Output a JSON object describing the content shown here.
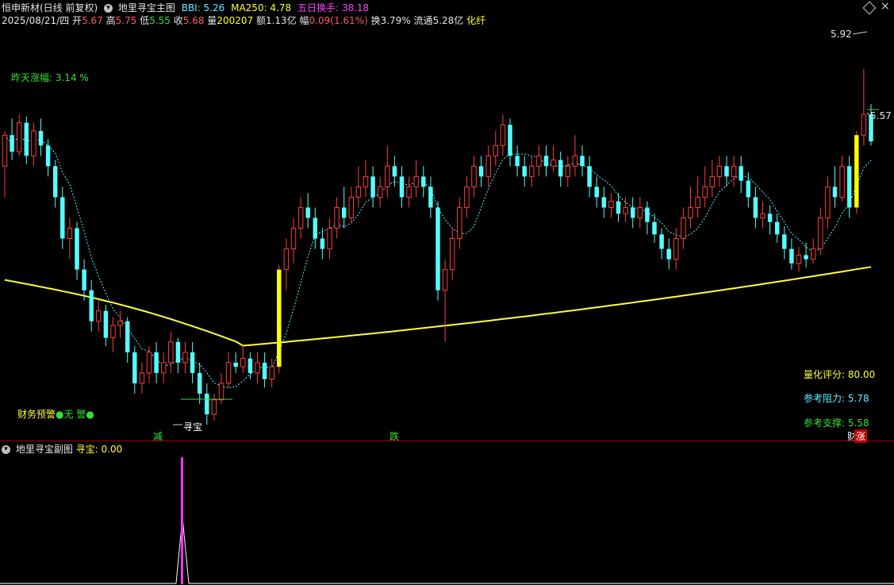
{
  "header": {
    "stock": "恒申新材(日线 前复权)",
    "indicator_main": "地里寻宝主图",
    "bbi": "BBI: 5.26",
    "ma250": "MA250: 4.78",
    "turnover5": "五日换手: 38.18"
  },
  "quote": {
    "date": "2025/08/21/四",
    "open_label": "开",
    "open": "5.67",
    "high_label": "高",
    "high": "5.75",
    "low_label": "低",
    "low": "5.55",
    "close_label": "收",
    "close": "5.68",
    "vol_label": "量",
    "vol": "200207",
    "amount_label": "额",
    "amount": "1.13亿",
    "range_label": "幅",
    "range": "0.09(1.61%)",
    "turnover_label": "换",
    "turnover": "3.79%",
    "float_label": "流通",
    "float": "5.28亿",
    "sector": "化纤"
  },
  "annotations": {
    "prev_change": "昨天涨幅: 3.14 %",
    "finance_warning": "财务预警",
    "no_warning": "无 警",
    "label_jian": "减",
    "label_xunbao": "寻宝",
    "label_die": "跌",
    "label_zhang": "涨",
    "label_cai": "财",
    "high_price": "5.92",
    "last_price": "5.57",
    "score": "量化评分: 80.00",
    "resistance": "参考阻力: 5.78",
    "support": "参考支撑: 5.58"
  },
  "sub_header": {
    "title": "地里寻宝副图",
    "value": "寻宝: 0.00"
  },
  "colors": {
    "up": "#ff3c3c",
    "down": "#54ffff",
    "ma250": "#ffff3c",
    "bbi": "#5ff0ff",
    "signal_bar": "#ffff00",
    "spike": "#ff30ff"
  },
  "chart_data": {
    "type": "candlestick",
    "price_range": [
      4.2,
      6.1
    ],
    "candles": [
      [
        5.45,
        5.6,
        5.62,
        5.3
      ],
      [
        5.6,
        5.52,
        5.68,
        5.48
      ],
      [
        5.52,
        5.66,
        5.7,
        5.5
      ],
      [
        5.66,
        5.5,
        5.69,
        5.46
      ],
      [
        5.5,
        5.62,
        5.66,
        5.45
      ],
      [
        5.62,
        5.55,
        5.68,
        5.5
      ],
      [
        5.55,
        5.45,
        5.58,
        5.4
      ],
      [
        5.45,
        5.3,
        5.48,
        5.25
      ],
      [
        5.3,
        5.1,
        5.35,
        5.05
      ],
      [
        5.1,
        5.15,
        5.2,
        5.0
      ],
      [
        5.15,
        4.95,
        5.18,
        4.9
      ],
      [
        4.95,
        4.85,
        5.0,
        4.8
      ],
      [
        4.85,
        4.7,
        4.9,
        4.65
      ],
      [
        4.7,
        4.75,
        4.8,
        4.65
      ],
      [
        4.75,
        4.62,
        4.78,
        4.58
      ],
      [
        4.62,
        4.68,
        4.72,
        4.55
      ],
      [
        4.68,
        4.7,
        4.75,
        4.62
      ],
      [
        4.7,
        4.55,
        4.72,
        4.5
      ],
      [
        4.55,
        4.4,
        4.58,
        4.35
      ],
      [
        4.4,
        4.45,
        4.5,
        4.35
      ],
      [
        4.45,
        4.55,
        4.58,
        4.4
      ],
      [
        4.55,
        4.45,
        4.6,
        4.4
      ],
      [
        4.45,
        4.5,
        4.55,
        4.4
      ],
      [
        4.5,
        4.6,
        4.65,
        4.45
      ],
      [
        4.6,
        4.5,
        4.62,
        4.45
      ],
      [
        4.5,
        4.55,
        4.6,
        4.45
      ],
      [
        4.55,
        4.45,
        4.6,
        4.4
      ],
      [
        4.45,
        4.35,
        4.5,
        4.3
      ],
      [
        4.35,
        4.25,
        4.4,
        4.2
      ],
      [
        4.25,
        4.32,
        4.35,
        4.22
      ],
      [
        4.32,
        4.4,
        4.45,
        4.3
      ],
      [
        4.4,
        4.5,
        4.55,
        4.38
      ],
      [
        4.5,
        4.48,
        4.55,
        4.45
      ],
      [
        4.48,
        4.52,
        4.58,
        4.45
      ],
      [
        4.52,
        4.45,
        4.55,
        4.42
      ],
      [
        4.45,
        4.5,
        4.55,
        4.4
      ],
      [
        4.5,
        4.42,
        4.55,
        4.38
      ],
      [
        4.42,
        4.48,
        4.52,
        4.38
      ],
      [
        4.48,
        4.95,
        4.97,
        4.45
      ],
      [
        4.95,
        5.05,
        5.1,
        4.85
      ],
      [
        5.05,
        5.15,
        5.2,
        4.98
      ],
      [
        5.15,
        5.25,
        5.3,
        5.1
      ],
      [
        5.25,
        5.2,
        5.32,
        5.15
      ],
      [
        5.2,
        5.1,
        5.25,
        5.05
      ],
      [
        5.1,
        5.05,
        5.15,
        5.0
      ],
      [
        5.05,
        5.15,
        5.2,
        5.0
      ],
      [
        5.15,
        5.25,
        5.3,
        5.1
      ],
      [
        5.25,
        5.2,
        5.35,
        5.15
      ],
      [
        5.2,
        5.3,
        5.35,
        5.18
      ],
      [
        5.3,
        5.35,
        5.45,
        5.25
      ],
      [
        5.35,
        5.4,
        5.48,
        5.3
      ],
      [
        5.4,
        5.3,
        5.45,
        5.25
      ],
      [
        5.3,
        5.35,
        5.4,
        5.25
      ],
      [
        5.35,
        5.45,
        5.55,
        5.3
      ],
      [
        5.45,
        5.4,
        5.5,
        5.35
      ],
      [
        5.4,
        5.3,
        5.45,
        5.25
      ],
      [
        5.3,
        5.35,
        5.4,
        5.25
      ],
      [
        5.35,
        5.4,
        5.48,
        5.3
      ],
      [
        5.4,
        5.35,
        5.45,
        5.3
      ],
      [
        5.35,
        5.25,
        5.4,
        5.2
      ],
      [
        5.25,
        4.85,
        5.28,
        4.8
      ],
      [
        4.85,
        4.95,
        5.0,
        4.6
      ],
      [
        4.95,
        5.1,
        5.15,
        4.9
      ],
      [
        5.1,
        5.25,
        5.3,
        5.05
      ],
      [
        5.25,
        5.35,
        5.4,
        5.2
      ],
      [
        5.35,
        5.45,
        5.5,
        5.3
      ],
      [
        5.45,
        5.4,
        5.5,
        5.35
      ],
      [
        5.4,
        5.5,
        5.55,
        5.35
      ],
      [
        5.5,
        5.55,
        5.62,
        5.45
      ],
      [
        5.55,
        5.65,
        5.7,
        5.5
      ],
      [
        5.65,
        5.5,
        5.68,
        5.45
      ],
      [
        5.5,
        5.45,
        5.55,
        5.4
      ],
      [
        5.45,
        5.4,
        5.5,
        5.35
      ],
      [
        5.4,
        5.45,
        5.5,
        5.35
      ],
      [
        5.45,
        5.5,
        5.55,
        5.4
      ],
      [
        5.5,
        5.45,
        5.55,
        5.4
      ],
      [
        5.45,
        5.48,
        5.55,
        5.42
      ],
      [
        5.48,
        5.4,
        5.52,
        5.35
      ],
      [
        5.4,
        5.45,
        5.5,
        5.35
      ],
      [
        5.45,
        5.5,
        5.6,
        5.4
      ],
      [
        5.5,
        5.45,
        5.55,
        5.4
      ],
      [
        5.45,
        5.35,
        5.5,
        5.3
      ],
      [
        5.35,
        5.3,
        5.4,
        5.25
      ],
      [
        5.3,
        5.25,
        5.35,
        5.2
      ],
      [
        5.25,
        5.28,
        5.32,
        5.2
      ],
      [
        5.28,
        5.22,
        5.32,
        5.18
      ],
      [
        5.22,
        5.25,
        5.3,
        5.18
      ],
      [
        5.25,
        5.2,
        5.3,
        5.15
      ],
      [
        5.2,
        5.25,
        5.3,
        5.15
      ],
      [
        5.25,
        5.18,
        5.28,
        5.12
      ],
      [
        5.18,
        5.12,
        5.22,
        5.08
      ],
      [
        5.12,
        5.05,
        5.15,
        5.0
      ],
      [
        5.05,
        5.0,
        5.1,
        4.95
      ],
      [
        5.0,
        5.1,
        5.15,
        4.95
      ],
      [
        5.1,
        5.2,
        5.25,
        5.05
      ],
      [
        5.2,
        5.25,
        5.35,
        5.15
      ],
      [
        5.25,
        5.3,
        5.4,
        5.2
      ],
      [
        5.3,
        5.35,
        5.45,
        5.25
      ],
      [
        5.35,
        5.4,
        5.48,
        5.3
      ],
      [
        5.4,
        5.45,
        5.5,
        5.35
      ],
      [
        5.45,
        5.4,
        5.5,
        5.35
      ],
      [
        5.4,
        5.45,
        5.5,
        5.35
      ],
      [
        5.45,
        5.38,
        5.5,
        5.32
      ],
      [
        5.38,
        5.3,
        5.42,
        5.25
      ],
      [
        5.3,
        5.2,
        5.35,
        5.15
      ],
      [
        5.2,
        5.22,
        5.28,
        5.15
      ],
      [
        5.22,
        5.18,
        5.26,
        5.12
      ],
      [
        5.18,
        5.12,
        5.22,
        5.08
      ],
      [
        5.12,
        5.05,
        5.16,
        5.0
      ],
      [
        5.05,
        4.98,
        5.1,
        4.95
      ],
      [
        4.98,
        5.02,
        5.06,
        4.94
      ],
      [
        5.02,
        5.0,
        5.08,
        4.96
      ],
      [
        5.0,
        5.05,
        5.1,
        4.98
      ],
      [
        5.05,
        5.2,
        5.25,
        5.02
      ],
      [
        5.2,
        5.35,
        5.4,
        5.15
      ],
      [
        5.35,
        5.3,
        5.45,
        5.25
      ],
      [
        5.3,
        5.45,
        5.5,
        5.28
      ],
      [
        5.45,
        5.25,
        5.5,
        5.2
      ],
      [
        5.25,
        5.6,
        5.62,
        5.22
      ],
      [
        5.6,
        5.7,
        5.92,
        5.55
      ],
      [
        5.7,
        5.57,
        5.75,
        5.55
      ]
    ]
  }
}
